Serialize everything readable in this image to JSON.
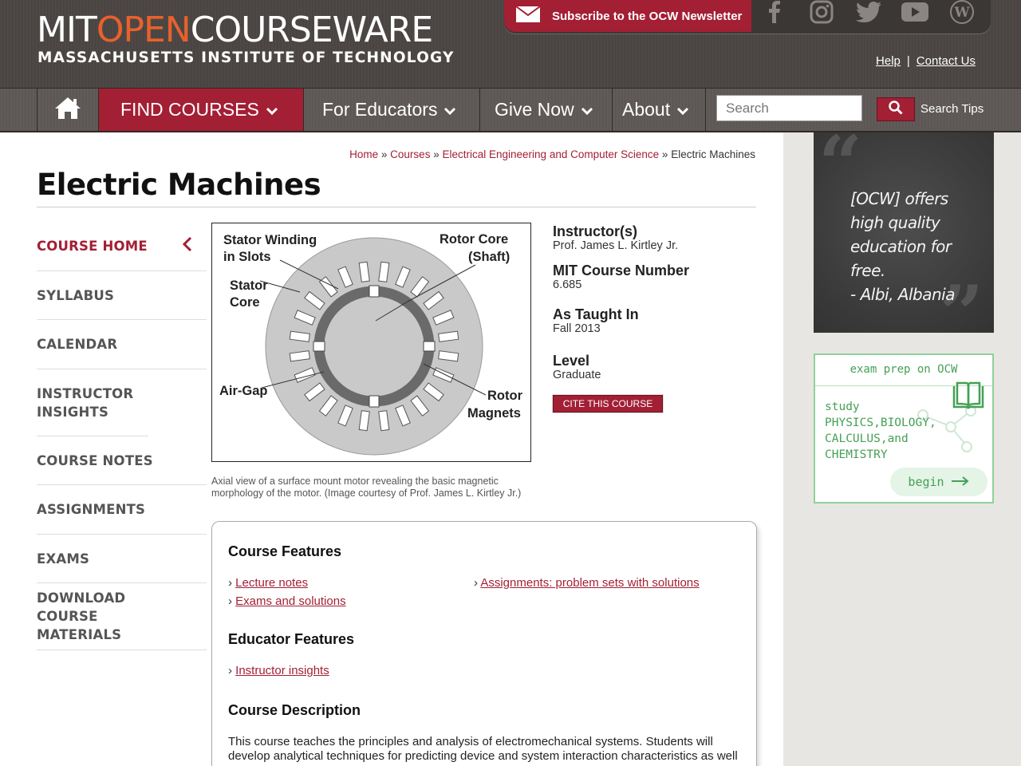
{
  "header": {
    "logo_mit": "MIT",
    "logo_open": "OPEN",
    "logo_courseware": "COURSEWARE",
    "logo_sub": "MASSACHUSETTS INSTITUTE OF TECHNOLOGY",
    "subscribe_label": "Subscribe to the OCW Newsletter",
    "social": [
      "facebook-icon",
      "instagram-icon",
      "twitter-icon",
      "youtube-icon",
      "wordpress-icon"
    ],
    "help_label": "Help",
    "separator": "|",
    "contact_label": "Contact Us"
  },
  "nav": {
    "find_courses": "FIND COURSES",
    "for_educators": "For Educators",
    "give_now": "Give Now",
    "about": "About",
    "search_placeholder": "Search",
    "search_tips": "Search Tips"
  },
  "breadcrumb": {
    "home": "Home",
    "courses": "Courses",
    "department": "Electrical Engineering and Computer Science",
    "current": "Electric Machines",
    "sep": "»"
  },
  "page": {
    "title": "Electric Machines"
  },
  "sidebar": {
    "items": [
      {
        "label": "COURSE HOME"
      },
      {
        "label": "SYLLABUS"
      },
      {
        "label": "CALENDAR"
      },
      {
        "label": "INSTRUCTOR INSIGHTS"
      },
      {
        "label": "COURSE NOTES"
      },
      {
        "label": "ASSIGNMENTS"
      },
      {
        "label": "EXAMS"
      },
      {
        "label": "DOWNLOAD COURSE MATERIALS"
      }
    ]
  },
  "figure": {
    "labels": {
      "stator_winding_1": "Stator Winding",
      "stator_winding_2": "in Slots",
      "rotor_core_1": "Rotor Core",
      "rotor_core_2": "(Shaft)",
      "stator_core_1": "Stator",
      "stator_core_2": "Core",
      "air_gap": "Air-Gap",
      "rotor_magnets_1": "Rotor",
      "rotor_magnets_2": "Magnets"
    },
    "caption": "Axial view of a surface mount motor revealing the basic magnetic morphology of the motor. (Image courtesy of Prof. James L. Kirtley Jr.)"
  },
  "course_info": {
    "instructor_label": "Instructor(s)",
    "instructor_value": "Prof. James L. Kirtley Jr.",
    "number_label": "MIT Course Number",
    "number_value": "6.685",
    "taught_label": "As Taught In",
    "taught_value": "Fall 2013",
    "level_label": "Level",
    "level_value": "Graduate",
    "cite_label": "CITE THIS COURSE"
  },
  "features": {
    "course_features_heading": "Course Features",
    "course_features": [
      "Lecture notes",
      "Exams and solutions",
      "Assignments: problem sets with solutions"
    ],
    "educator_features_heading": "Educator Features",
    "educator_features": [
      "Instructor insights"
    ],
    "description_heading": "Course Description",
    "description": "This course teaches the principles and analysis of electromechanical systems. Students will develop analytical techniques for predicting device and system interaction characteristics as well"
  },
  "promo": {
    "quote": "[OCW] offers high quality education for free.",
    "quote_attribution": "- Albi, Albania",
    "exam_heading": "exam prep on OCW",
    "exam_study": "study",
    "exam_subjects": "PHYSICS,BIOLOGY, CALCULUS,and CHEMISTRY",
    "exam_begin": "begin"
  },
  "colors": {
    "accent": "#a31f34",
    "header_bg": "#4a4542",
    "nav_bg": "#5c5755",
    "logo_open": "#e8612c",
    "exam_green": "#45a055"
  }
}
